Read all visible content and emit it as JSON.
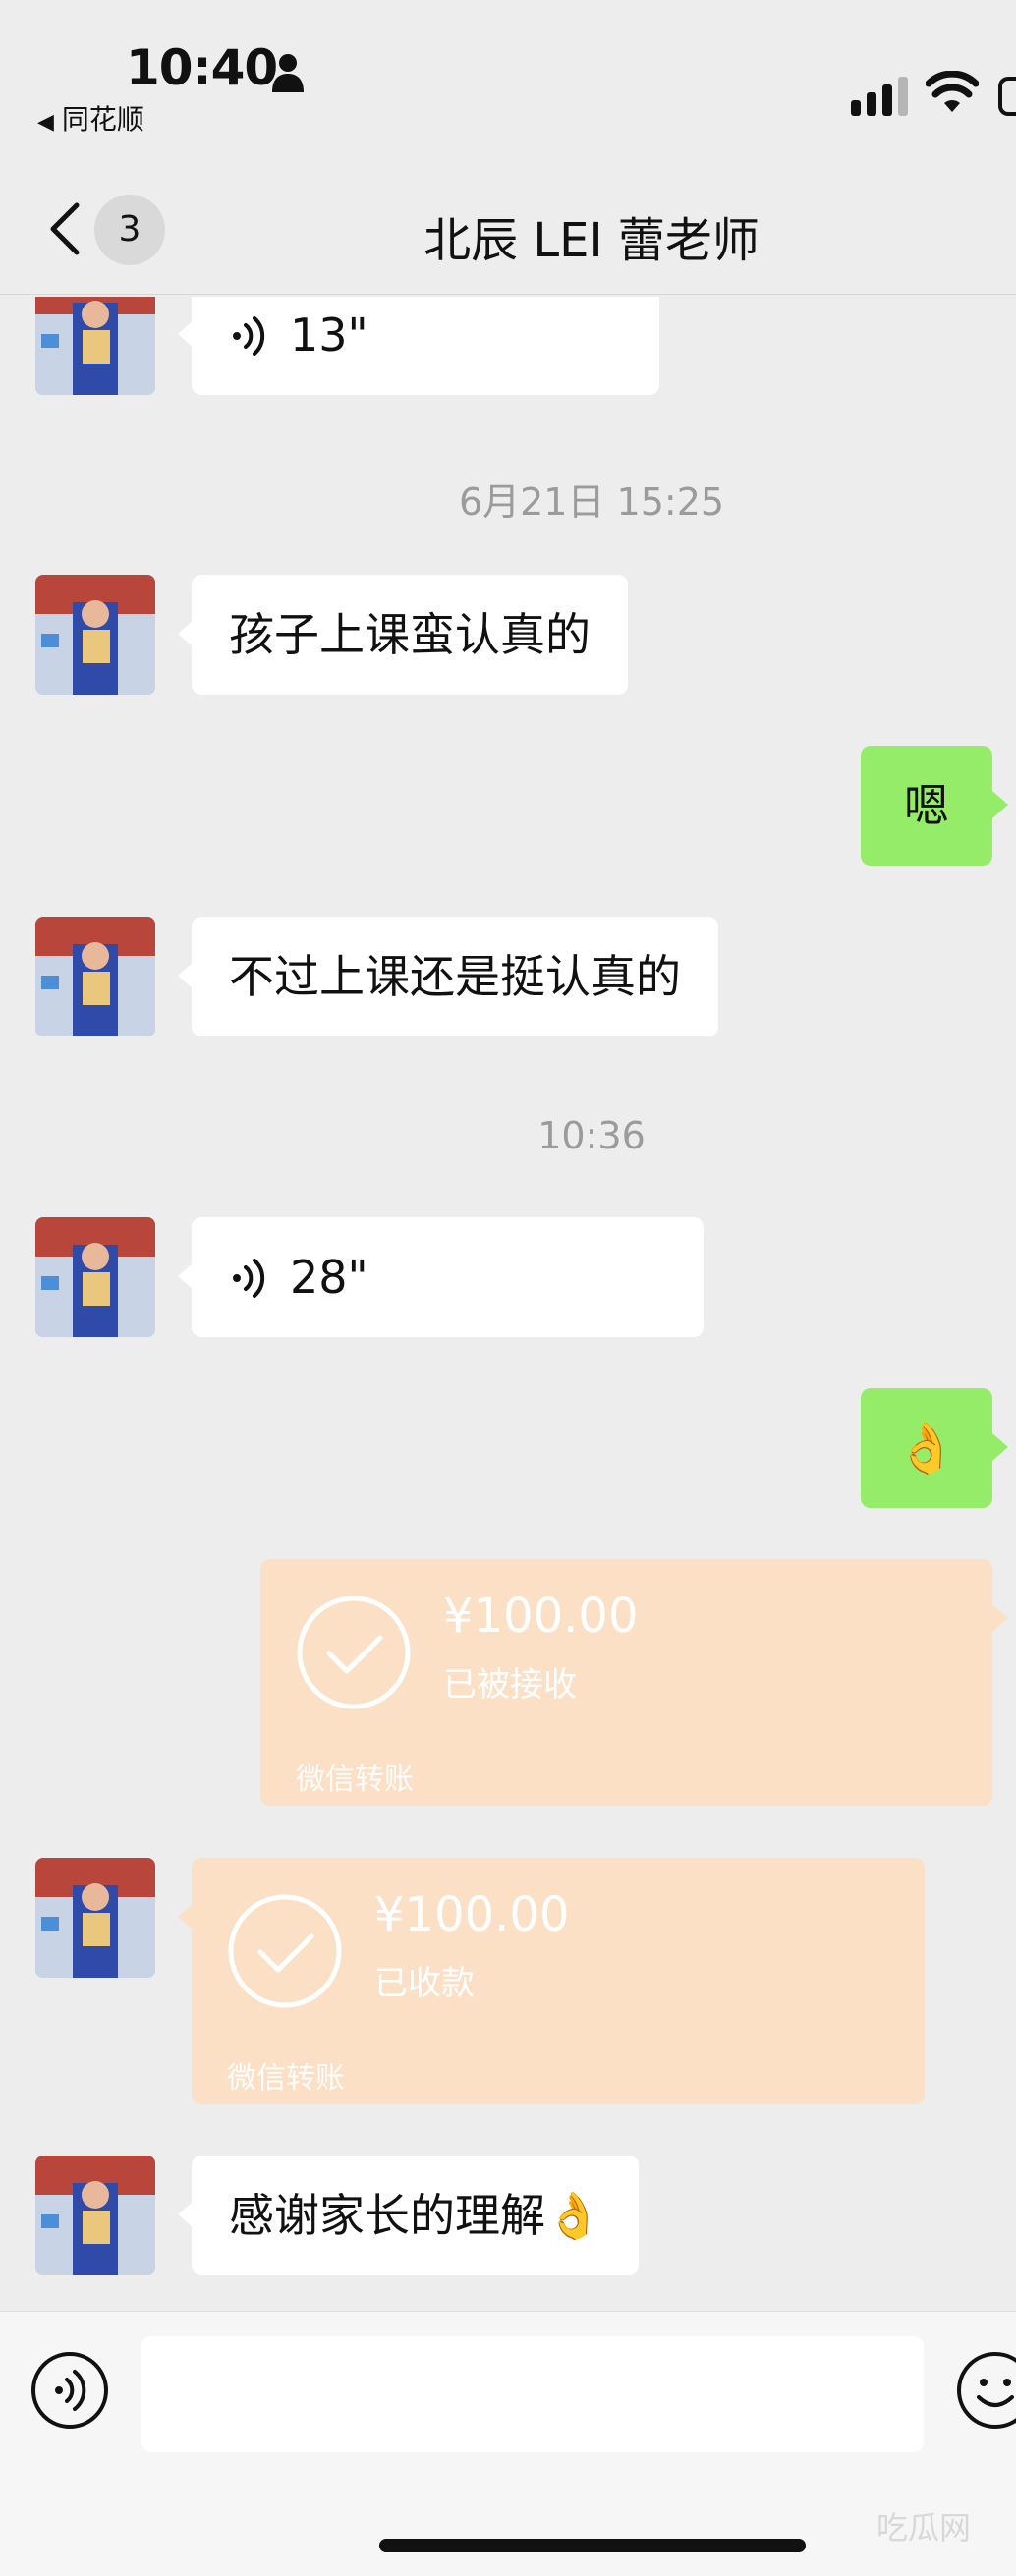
{
  "status_bar": {
    "time": "10:40",
    "back_app": "同花顺",
    "icons": [
      "person-icon",
      "cellular-signal-icon",
      "wifi-icon",
      "battery-icon"
    ]
  },
  "nav": {
    "back_icon": "chevron-left-icon",
    "unread_count": "3",
    "title": "北辰 LEI 蕾老师"
  },
  "messages": [
    {
      "kind": "voice",
      "side": "in",
      "duration": "13\""
    },
    {
      "kind": "timestamp",
      "text": "6月21日 15:25"
    },
    {
      "kind": "text",
      "side": "in",
      "text": "孩子上课蛮认真的"
    },
    {
      "kind": "text",
      "side": "out",
      "text": "嗯"
    },
    {
      "kind": "text",
      "side": "in",
      "text": "不过上课还是挺认真的"
    },
    {
      "kind": "timestamp",
      "text": "10:36"
    },
    {
      "kind": "voice",
      "side": "in",
      "duration": "28\""
    },
    {
      "kind": "emoji",
      "side": "out",
      "text": "👌"
    },
    {
      "kind": "transfer",
      "side": "out",
      "amount": "¥100.00",
      "status": "已被接收",
      "footer": "微信转账"
    },
    {
      "kind": "transfer",
      "side": "in",
      "amount": "¥100.00",
      "status": "已收款",
      "footer": "微信转账"
    },
    {
      "kind": "text",
      "side": "in",
      "text": "感谢家长的理解👌"
    }
  ],
  "input_bar": {
    "voice_icon": "voice-input-icon",
    "emoji_icon": "emoji-icon"
  },
  "colors": {
    "background": "#ededed",
    "incoming_bubble": "#ffffff",
    "outgoing_bubble": "#95ec69",
    "transfer_card": "#fce0c5",
    "timestamp_text": "#9b9b9b"
  },
  "watermark": "吃瓜网"
}
